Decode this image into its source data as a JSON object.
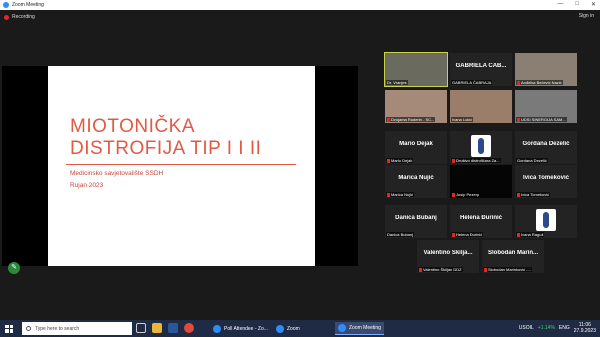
{
  "window": {
    "title": "Zoom Meeting",
    "recording": "Recording",
    "sign_in": "Sign in",
    "controls": [
      "—",
      "□",
      "✕"
    ]
  },
  "share": {
    "title_line1": "MIOTONIČKA",
    "title_line2": "DISTROFIJA TIP I I II",
    "subtitle": "Medicinsko savjetovalište SSDH",
    "date": "Rujan 2023"
  },
  "gallery": [
    {
      "big": "",
      "caption": "Dr. Vranjes",
      "active": true,
      "video": "#6b6a5e",
      "muted": false
    },
    {
      "big": "GABRIELA ČAB...",
      "caption": "GABRIELA ČABRAJA",
      "active": false,
      "video": "",
      "muted": false
    },
    {
      "big": "",
      "caption": "Anđelka Bečević Nazić",
      "active": false,
      "video": "#8a7f72",
      "muted": true
    },
    {
      "big": "",
      "caption": "Dvojama Ruderin - SC...",
      "active": false,
      "video": "#a58a7a",
      "muted": true
    },
    {
      "big": "",
      "caption": "Ivana Lukić",
      "active": false,
      "video": "#9a7e6a",
      "muted": false
    },
    {
      "big": "",
      "caption": "UDSI SINERGIJA SAM...",
      "active": false,
      "video": "#7a7a7a",
      "muted": true
    },
    {
      "big": "Mario Dejak",
      "caption": "Mario Dejak",
      "active": false,
      "video": "",
      "muted": true
    },
    {
      "big": "",
      "caption": "Društvo distrofičara Za...",
      "active": false,
      "video": "logo",
      "muted": true
    },
    {
      "big": "Gordana Dezelić",
      "caption": "Gordana Dezelić",
      "active": false,
      "video": "",
      "muted": false
    },
    {
      "big": "Marica Nujić",
      "caption": "Marica Nujić",
      "active": false,
      "video": "",
      "muted": true
    },
    {
      "big": "",
      "caption": "Josip Pezerp",
      "active": false,
      "video": "#050505",
      "muted": true
    },
    {
      "big": "Ivica Tomeković",
      "caption": "Ivica Tomeković",
      "active": false,
      "video": "",
      "muted": true
    },
    {
      "big": "Danica Bubanj",
      "caption": "Danica Bubanj",
      "active": false,
      "video": "",
      "muted": false
    },
    {
      "big": "Helena Đurinić",
      "caption": "Helena Đurinić",
      "active": false,
      "video": "",
      "muted": true
    },
    {
      "big": "",
      "caption": "Ivana Raguž",
      "active": false,
      "video": "logo",
      "muted": true
    },
    {
      "big": "Valentino Škilja...",
      "caption": "Valentino Škiljan DDZ",
      "active": false,
      "video": "",
      "muted": true
    },
    {
      "big": "Slobodan Marin...",
      "caption": "Slobodan Marinković -...",
      "active": false,
      "video": "",
      "muted": true
    }
  ],
  "taskbar": {
    "search_placeholder": "Type here to search",
    "apps": [
      {
        "label": "Poll Attendee - Zo...",
        "color": "#2d8cff",
        "active": false
      },
      {
        "label": "Zoom",
        "color": "#2d8cff",
        "active": false
      },
      {
        "label": "Zoom Meeting",
        "color": "#2d8cff",
        "active": true
      }
    ],
    "stock": "USOIL",
    "stock_change": "+1.14%",
    "time": "11:06",
    "date": "27.9.2023",
    "lang": "ENG"
  }
}
